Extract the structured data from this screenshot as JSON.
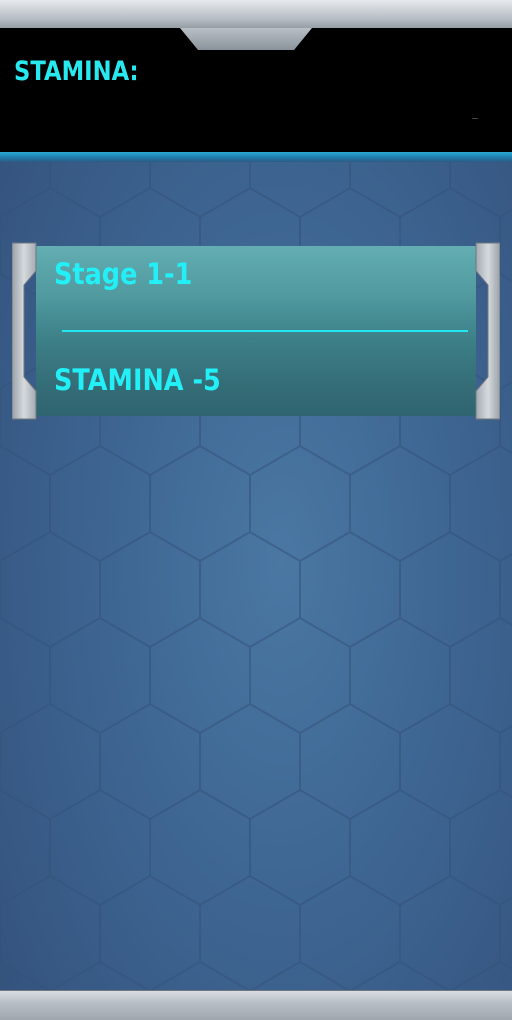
{
  "header": {
    "stamina_label": "STAMINA:",
    "stamina_value": ""
  },
  "stages": [
    {
      "title": "Stage 1-1",
      "cost": "STAMINA -5"
    }
  ],
  "colors": {
    "accent_text": "#22f0f6",
    "header_bg": "#000000",
    "card_top": "#63aeb2",
    "card_bottom": "#2f6470",
    "background": "#3f6794",
    "frame_metal": "#b8bec6"
  }
}
